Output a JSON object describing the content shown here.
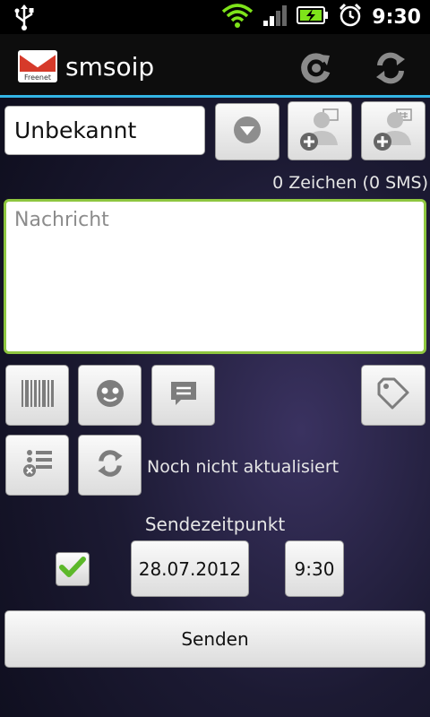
{
  "status_bar": {
    "time": "9:30",
    "icons": [
      "usb-icon",
      "wifi-icon",
      "signal-icon",
      "battery-charging-icon",
      "alarm-icon"
    ]
  },
  "app": {
    "title": "smsoip",
    "logo_text": "Freenet",
    "accent_color": "#33b5e5",
    "actions": [
      "refresh-balance-icon",
      "refresh-icon"
    ]
  },
  "recipient": {
    "value": "Unbekannt"
  },
  "counter": "0 Zeichen (0 SMS)",
  "message": {
    "placeholder": "Nachricht",
    "border_color": "#8ec63f"
  },
  "toolbar": {
    "icons": [
      "barcode-icon",
      "smiley-icon",
      "text-bubble-icon",
      "tag-icon"
    ]
  },
  "update": {
    "status": "Noch nicht aktualisiert",
    "icons": [
      "provider-list-icon",
      "refresh-icon"
    ]
  },
  "schedule": {
    "label": "Sendezeitpunkt",
    "checked": true,
    "date": "28.07.2012",
    "time": "9:30"
  },
  "send_label": "Senden"
}
